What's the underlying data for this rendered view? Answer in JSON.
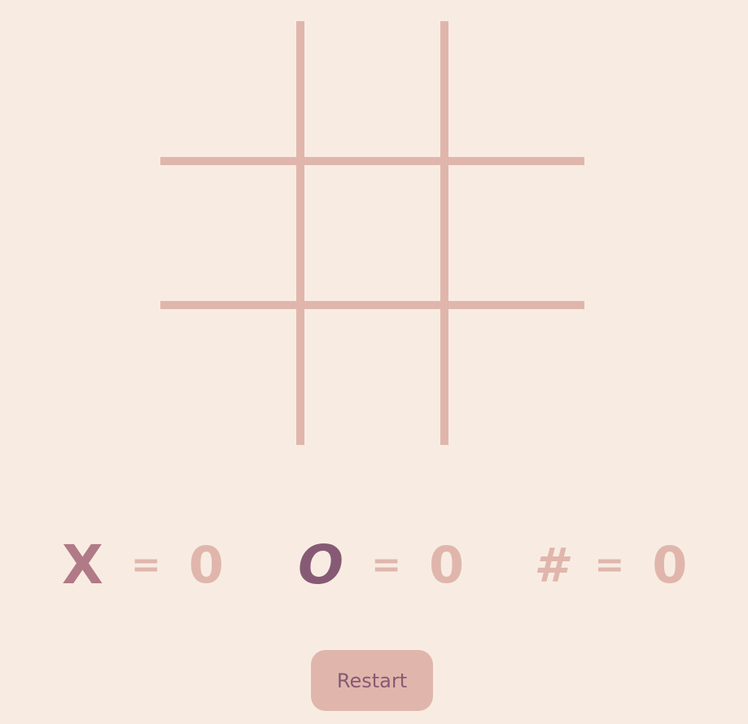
{
  "game": {
    "board": [
      "",
      "",
      "",
      "",
      "",
      "",
      "",
      "",
      ""
    ]
  },
  "scoreboard": {
    "x": {
      "symbol": "X",
      "equals": "=",
      "value": "0"
    },
    "o": {
      "symbol": "O",
      "equals": "=",
      "value": "0"
    },
    "tie": {
      "symbol": "#",
      "equals": "=",
      "value": "0"
    }
  },
  "controls": {
    "restart_label": "Restart"
  },
  "colors": {
    "background": "#f8ece2",
    "grid": "#e0b6ac",
    "x_mark": "#b07a86",
    "o_mark": "#865a74",
    "button_bg": "#e0b6ac",
    "button_text": "#865a74"
  }
}
